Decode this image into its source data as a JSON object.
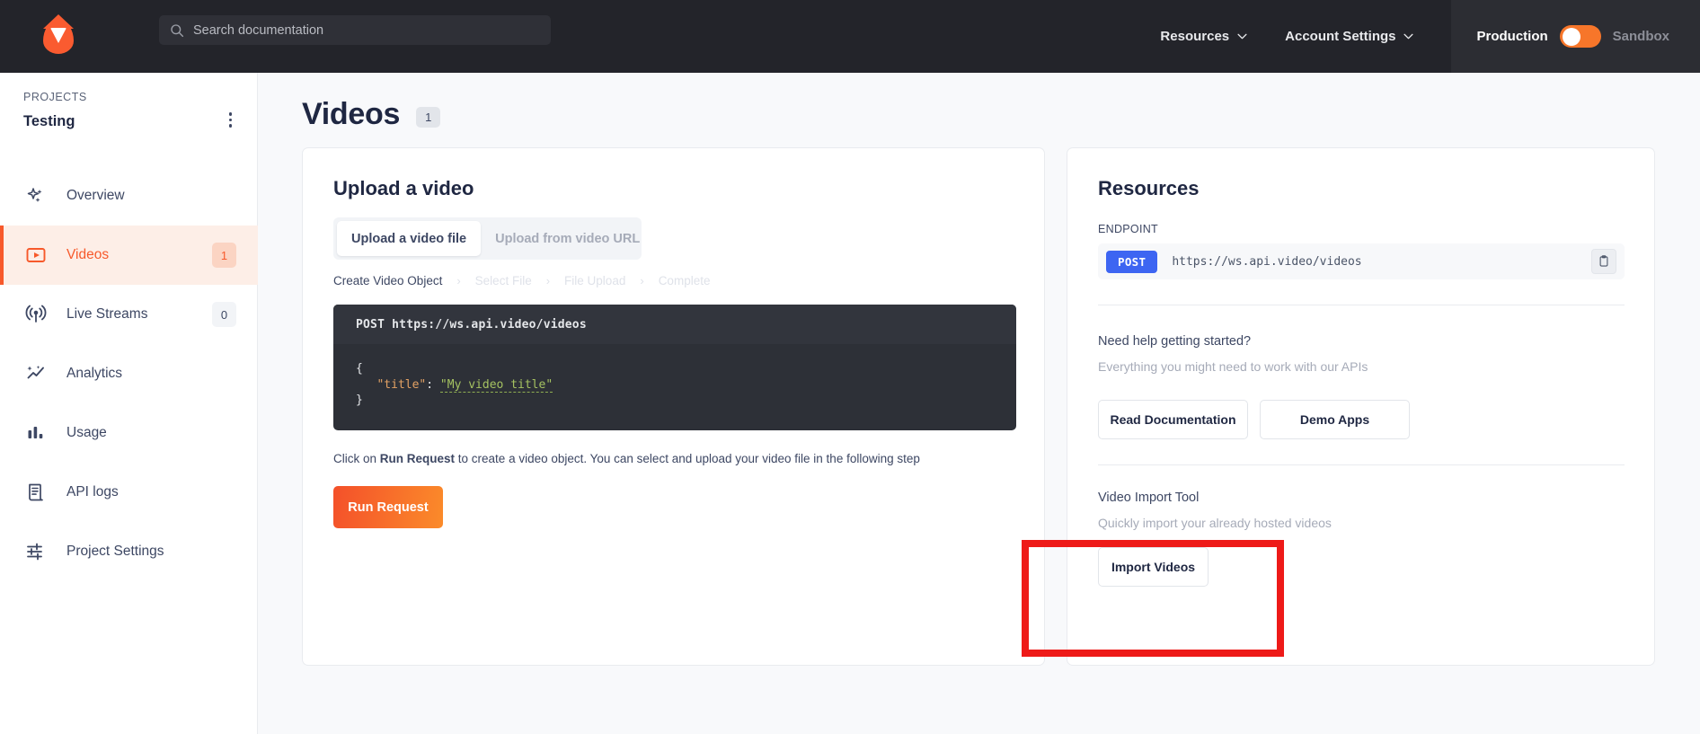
{
  "topbar": {
    "logo_icon": "apivideo-flame-logo",
    "search": {
      "icon": "search-icon",
      "placeholder": "Search documentation",
      "value": ""
    },
    "nav": [
      {
        "label": "Resources",
        "icon": "chevron-down-icon"
      },
      {
        "label": "Account Settings",
        "icon": "chevron-down-icon"
      }
    ],
    "env_toggle": {
      "left_label": "Production",
      "right_label": "Sandbox",
      "state": "Production",
      "accent": "#f7762a"
    }
  },
  "sidebar": {
    "section_label": "PROJECTS",
    "project_name": "Testing",
    "kebab_icon": "more-vertical-icon",
    "items": [
      {
        "label": "Overview",
        "icon": "sparkles-icon",
        "badge": null,
        "active": false
      },
      {
        "label": "Videos",
        "icon": "video-play-icon",
        "badge": "1",
        "active": true
      },
      {
        "label": "Live Streams",
        "icon": "broadcast-icon",
        "badge": "0",
        "active": false
      },
      {
        "label": "Analytics",
        "icon": "analytics-icon",
        "badge": null,
        "active": false
      },
      {
        "label": "Usage",
        "icon": "bar-chart-icon",
        "badge": null,
        "active": false
      },
      {
        "label": "API logs",
        "icon": "logs-icon",
        "badge": null,
        "active": false
      },
      {
        "label": "Project Settings",
        "icon": "sliders-icon",
        "badge": null,
        "active": false
      }
    ]
  },
  "main": {
    "page_title": "Videos",
    "page_title_badge": "1",
    "upload_card": {
      "heading": "Upload a video",
      "tabs": [
        {
          "label": "Upload a video file",
          "active": true
        },
        {
          "label": "Upload from video URL",
          "active": false
        }
      ],
      "stepper": [
        {
          "label": "Create Video Object",
          "state": "done"
        },
        {
          "label": "Select File",
          "state": "todo"
        },
        {
          "label": "File Upload",
          "state": "todo"
        },
        {
          "label": "Complete",
          "state": "todo"
        }
      ],
      "step_separator": "›",
      "code": {
        "method": "POST",
        "url": "https://ws.api.video/videos",
        "brace_open": "{",
        "key": "\"title\"",
        "colon": ":",
        "value": "\"My video title\"",
        "brace_close": "}"
      },
      "hint_prefix": "Click on ",
      "hint_bold": "Run Request",
      "hint_suffix": " to create a video object. You can select and upload your video file in the following step",
      "run_button": "Run Request"
    },
    "resources_card": {
      "heading": "Resources",
      "endpoint_label": "ENDPOINT",
      "endpoint_method": "POST",
      "endpoint_url": "https://ws.api.video/videos",
      "copy_icon": "clipboard-copy-icon",
      "help_title": "Need help getting started?",
      "help_sub": "Everything you might need to work with our APIs",
      "btn_read_docs": "Read Documentation",
      "btn_demo_apps": "Demo Apps",
      "import_title": "Video Import Tool",
      "import_sub": "Quickly import your already hosted videos",
      "btn_import": "Import Videos"
    }
  },
  "annotation": {
    "highlight_color": "#ee1a18",
    "highlight_target": "video-import-tool-section"
  }
}
